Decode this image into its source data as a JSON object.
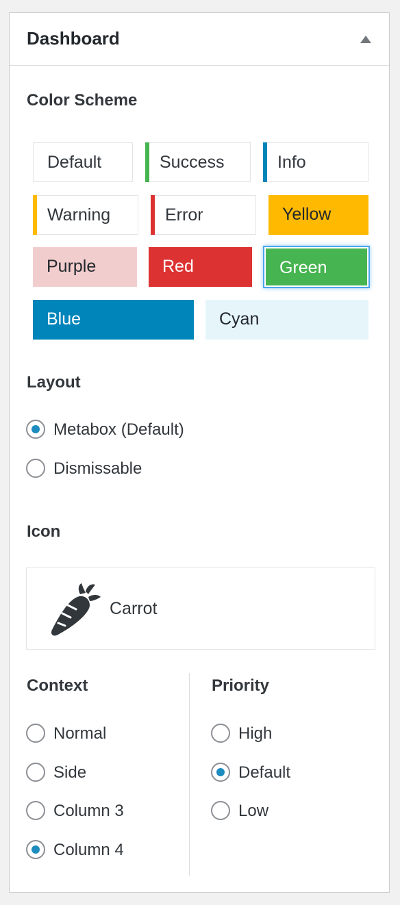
{
  "panel": {
    "title": "Dashboard"
  },
  "color_scheme": {
    "title": "Color Scheme",
    "options": [
      {
        "label": "Default",
        "accent": "#ffffff",
        "text": "#32373c"
      },
      {
        "label": "Success",
        "accent": "#46b450",
        "text": "#32373c"
      },
      {
        "label": "Info",
        "accent": "#0085ba",
        "text": "#32373c"
      },
      {
        "label": "Warning",
        "accent": "#ffb900",
        "text": "#32373c"
      },
      {
        "label": "Error",
        "accent": "#dc3232",
        "text": "#32373c"
      },
      {
        "label": "Yellow",
        "accent": "#ffb900",
        "text": "#23282d"
      },
      {
        "label": "Purple",
        "accent": "#f2cdcd",
        "text": "#23282d"
      },
      {
        "label": "Red",
        "accent": "#dc3232",
        "text": "#ffffff"
      },
      {
        "label": "Green",
        "accent": "#46b450",
        "text": "#ffffff",
        "selected": true
      },
      {
        "label": "Blue",
        "accent": "#0085ba",
        "text": "#ffffff"
      },
      {
        "label": "Cyan",
        "accent": "#e5f5fa",
        "text": "#23282d"
      }
    ]
  },
  "layout": {
    "title": "Layout",
    "options": [
      {
        "label": "Metabox (Default)",
        "checked": true
      },
      {
        "label": "Dismissable",
        "checked": false
      }
    ]
  },
  "icon": {
    "title": "Icon",
    "selected_label": "Carrot",
    "icon_name": "carrot-icon"
  },
  "context": {
    "title": "Context",
    "options": [
      {
        "label": "Normal",
        "checked": false
      },
      {
        "label": "Side",
        "checked": false
      },
      {
        "label": "Column 3",
        "checked": false
      },
      {
        "label": "Column 4",
        "checked": true
      }
    ]
  },
  "priority": {
    "title": "Priority",
    "options": [
      {
        "label": "High",
        "checked": false
      },
      {
        "label": "Default",
        "checked": true
      },
      {
        "label": "Low",
        "checked": false
      }
    ]
  }
}
